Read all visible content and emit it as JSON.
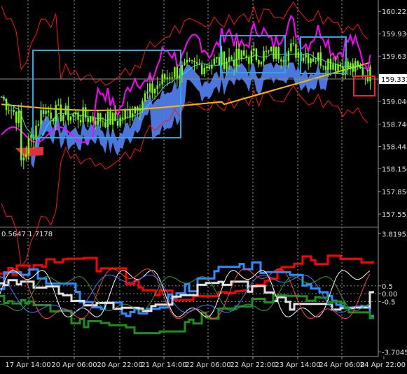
{
  "main_chart": {
    "price_min": 157.4,
    "price_max": 160.3,
    "price_labels": [
      {
        "value": 160.225,
        "text": "160.225"
      },
      {
        "value": 159.93,
        "text": "159.930"
      },
      {
        "value": 159.635,
        "text": "159.635"
      },
      {
        "value": 159.333,
        "text": "159.333",
        "current": true
      },
      {
        "value": 159.04,
        "text": "159.040"
      },
      {
        "value": 158.74,
        "text": "158.740"
      },
      {
        "value": 158.445,
        "text": "158.445"
      },
      {
        "value": 158.15,
        "text": "158.150"
      },
      {
        "value": 157.85,
        "text": "157.850"
      },
      {
        "value": 157.555,
        "text": "157.555"
      }
    ],
    "current_price": 159.333
  },
  "sub_chart": {
    "value_min": -4.0,
    "value_max": 4.1,
    "header_left": "0.5647",
    "header_right": "1.7178",
    "value_labels": [
      {
        "value": 3.8195,
        "text": "3.8195"
      },
      {
        "value": 0.5,
        "text": "0.5"
      },
      {
        "value": 0.0,
        "text": "0.00"
      },
      {
        "value": -0.5,
        "text": "-0.5"
      },
      {
        "value": -3.7045,
        "text": "-3.7045"
      }
    ],
    "levels": [
      0.5,
      0.0,
      -0.5
    ]
  },
  "time_axis": [
    "17 Apr 14:00",
    "20 Apr 06:00",
    "20 Apr 22:00",
    "21 Apr 14:00",
    "22 Apr 06:00",
    "22 Apr 22:00",
    "23 Apr 14:00",
    "24 Apr 06:00",
    "24 Apr 22:00"
  ],
  "colors": {
    "background": "#000000",
    "candle": "#7CFC00",
    "cloud": "#4F7DE8",
    "cloud_bear": "#E03040",
    "bollinger": "#FF1010",
    "ma_fast": "#FF00FF",
    "ma_slow": "#FFB800",
    "ma_mid": "#2BD9E8",
    "zone_box": "#29A9E1",
    "alert_box": "#FF2020",
    "sub_red": "#FF0000",
    "sub_blue": "#2F8CFF",
    "sub_white": "#E0E0E0",
    "sub_green": "#1E8E1E"
  }
}
